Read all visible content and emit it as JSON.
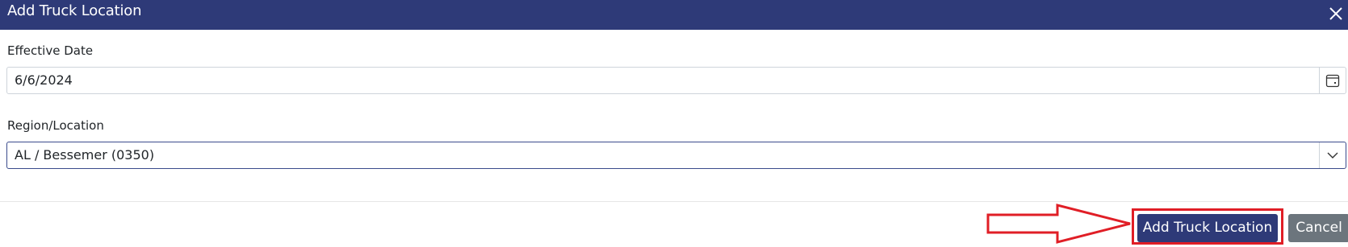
{
  "dialog": {
    "title": "Add Truck Location",
    "close_icon": "close-icon"
  },
  "fields": {
    "effective_date": {
      "label": "Effective Date",
      "value": "6/6/2024",
      "icon": "calendar-icon"
    },
    "region_location": {
      "label": "Region/Location",
      "value": "AL / Bessemer (0350)",
      "icon": "chevron-down-icon"
    }
  },
  "footer": {
    "primary_label": "Add Truck Location",
    "secondary_label": "Cancel"
  },
  "annotation": {
    "arrow_icon": "arrow-right-outline",
    "highlight_color": "#e01e26"
  },
  "colors": {
    "header": "#2e3a78",
    "primary_button": "#2e3a78",
    "secondary_button": "#6c757d"
  }
}
